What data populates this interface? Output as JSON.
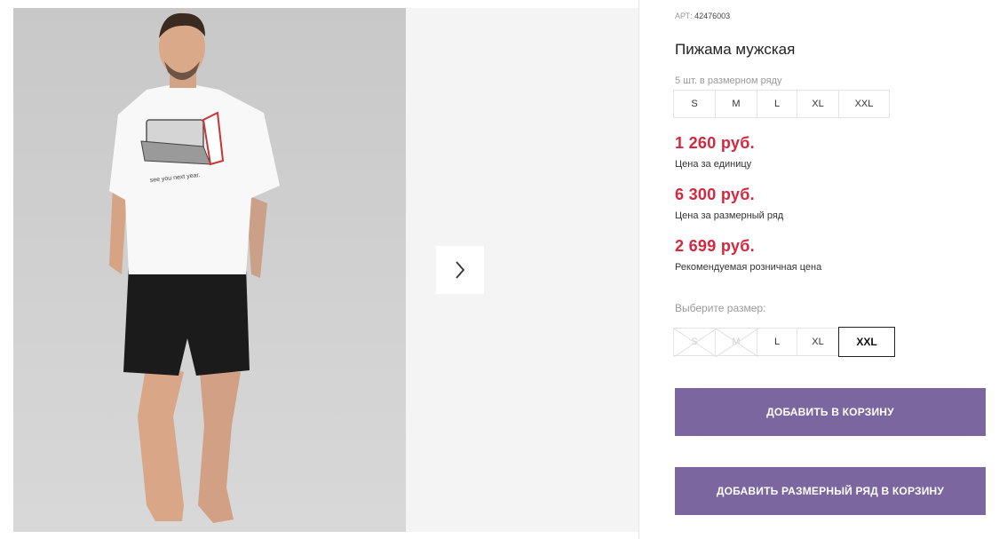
{
  "gallery": {
    "next_icon": "chevron-right-icon",
    "photo_print_text": "see you next year."
  },
  "product": {
    "article_label": "АРТ:",
    "article_value": "42476003",
    "title": "Пижама мужская",
    "size_row_note": "5 шт. в размерном ряду",
    "size_row": [
      "S",
      "M",
      "L",
      "XL",
      "XXL"
    ],
    "prices": [
      {
        "value": "1 260 руб.",
        "label": "Цена за единицу"
      },
      {
        "value": "6 300 руб.",
        "label": "Цена за размерный ряд"
      },
      {
        "value": "2 699 руб.",
        "label": "Рекомендуемая розничная цена"
      }
    ],
    "choose_size_label": "Выберите размер:",
    "size_options": [
      {
        "label": "S",
        "available": false
      },
      {
        "label": "M",
        "available": false
      },
      {
        "label": "L",
        "available": true
      },
      {
        "label": "XL",
        "available": true
      },
      {
        "label": "XXL",
        "available": true,
        "selected": true
      }
    ],
    "add_to_cart_label": "ДОБАВИТЬ В КОРЗИНУ",
    "add_size_row_label": "ДОБАВИТЬ РАЗМЕРНЫЙ РЯД В КОРЗИНУ"
  },
  "colors": {
    "price": "#d7263d",
    "button": "#7b669f",
    "selected_border": "#222222"
  }
}
